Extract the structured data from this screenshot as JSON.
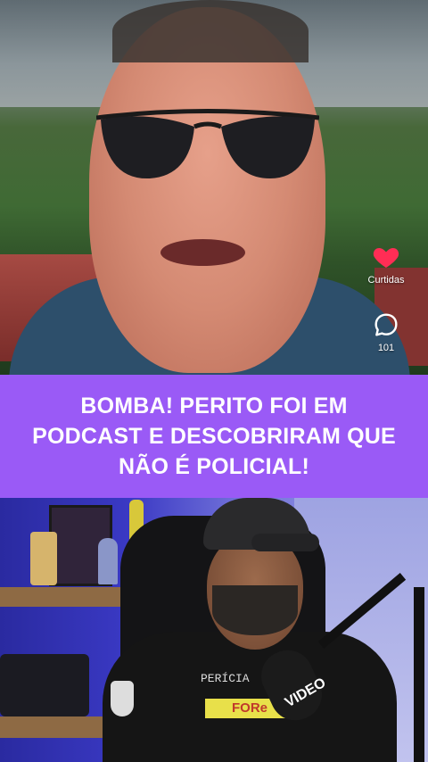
{
  "reel": {
    "likes_label": "Curtidas",
    "comments_count": "101"
  },
  "banner": {
    "headline": "BOMBA! PERITO FOI EM PODCAST E DESCOBRIRAM QUE NÃO É POLICIAL!"
  },
  "podcast_frame": {
    "shirt_text": "PERÍCIA",
    "shirt_badge": "FORe",
    "mic_label": "VIDEO"
  },
  "colors": {
    "banner": "#9a5af6",
    "heart": "#ff2d55"
  },
  "icons": [
    "heart-icon",
    "comment-icon"
  ]
}
